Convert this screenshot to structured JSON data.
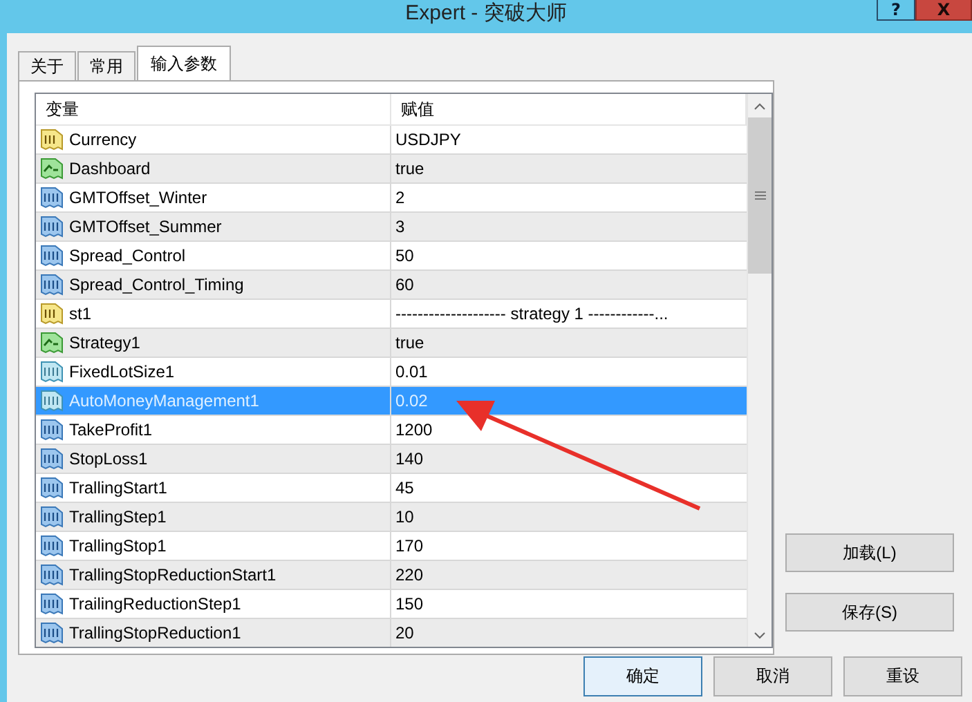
{
  "window": {
    "title": "Expert - 突破大师",
    "help": "?",
    "close": "X"
  },
  "tabs": [
    {
      "label": "关于",
      "selected": false
    },
    {
      "label": "常用",
      "selected": false
    },
    {
      "label": "输入参数",
      "selected": true
    }
  ],
  "table": {
    "columns": [
      "变量",
      "赋值"
    ],
    "rows": [
      {
        "kind": "string",
        "name": "Currency",
        "value": "USDJPY",
        "selected": false
      },
      {
        "kind": "bool",
        "name": "Dashboard",
        "value": "true",
        "selected": false
      },
      {
        "kind": "int",
        "name": "GMTOffset_Winter",
        "value": "2",
        "selected": false
      },
      {
        "kind": "int",
        "name": "GMTOffset_Summer",
        "value": "3",
        "selected": false
      },
      {
        "kind": "int",
        "name": "Spread_Control",
        "value": "50",
        "selected": false
      },
      {
        "kind": "int",
        "name": "Spread_Control_Timing",
        "value": "60",
        "selected": false
      },
      {
        "kind": "string",
        "name": "st1",
        "value": "--------------------    strategy 1    ------------...",
        "selected": false
      },
      {
        "kind": "bool",
        "name": "Strategy1",
        "value": "true",
        "selected": false
      },
      {
        "kind": "double",
        "name": "FixedLotSize1",
        "value": "0.01",
        "selected": false
      },
      {
        "kind": "double",
        "name": "AutoMoneyManagement1",
        "value": "0.02",
        "selected": true
      },
      {
        "kind": "int",
        "name": "TakeProfit1",
        "value": "1200",
        "selected": false
      },
      {
        "kind": "int",
        "name": "StopLoss1",
        "value": "140",
        "selected": false
      },
      {
        "kind": "int",
        "name": "TrallingStart1",
        "value": "45",
        "selected": false
      },
      {
        "kind": "int",
        "name": "TrallingStep1",
        "value": "10",
        "selected": false
      },
      {
        "kind": "int",
        "name": "TrallingStop1",
        "value": "170",
        "selected": false
      },
      {
        "kind": "int",
        "name": "TrallingStopReductionStart1",
        "value": "220",
        "selected": false
      },
      {
        "kind": "int",
        "name": "TrailingReductionStep1",
        "value": "150",
        "selected": false
      },
      {
        "kind": "int",
        "name": "TrallingStopReduction1",
        "value": "20",
        "selected": false
      }
    ]
  },
  "side_buttons": [
    "加载(L)",
    "保存(S)"
  ],
  "buttons": [
    "确定",
    "取消",
    "重设"
  ]
}
